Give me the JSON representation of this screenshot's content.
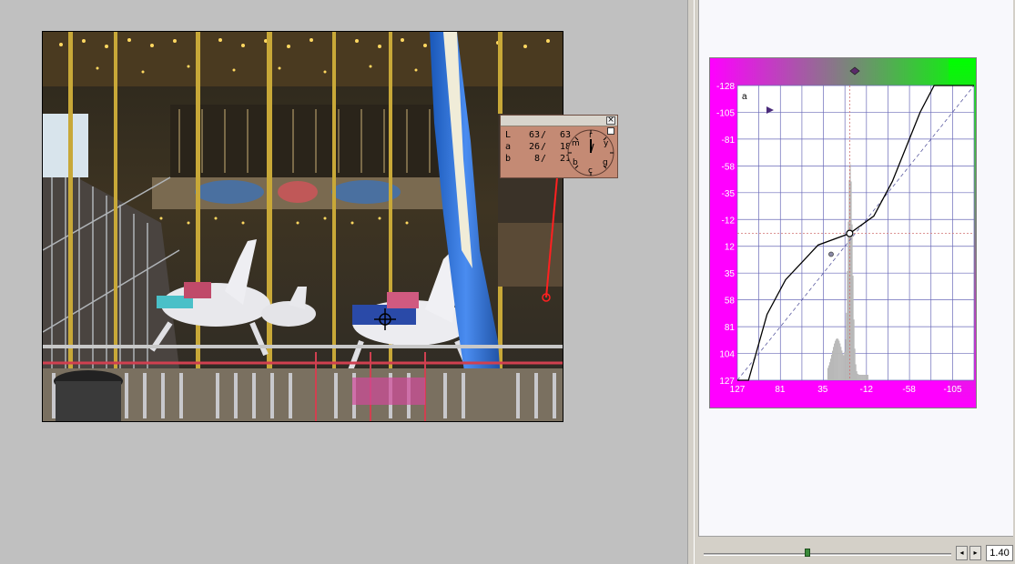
{
  "readout": {
    "rows": [
      {
        "channel": "L",
        "before": "63",
        "after": "63"
      },
      {
        "channel": "a",
        "before": "26",
        "after": "18"
      },
      {
        "channel": "b",
        "before": "8",
        "after": "21"
      }
    ],
    "dial_labels": [
      "m",
      "r",
      "y",
      "g",
      "c",
      "b"
    ],
    "close_glyph": "×",
    "pin_glyph": "▪"
  },
  "curve": {
    "channel_label": "a",
    "y_ticks": [
      "-128",
      "-105",
      "-81",
      "-58",
      "-35",
      "-12",
      "12",
      "35",
      "58",
      "81",
      "104",
      "127"
    ],
    "x_ticks": [
      "127",
      "81",
      "35",
      "-12",
      "-58",
      "-105"
    ],
    "curve_points": [
      [
        127,
        127
      ],
      [
        115,
        127
      ],
      [
        95,
        70
      ],
      [
        75,
        40
      ],
      [
        40,
        10
      ],
      [
        6,
        0
      ],
      [
        -20,
        -15
      ],
      [
        -40,
        -45
      ],
      [
        -70,
        -105
      ],
      [
        -85,
        -128
      ],
      [
        -128,
        -128
      ]
    ],
    "colors": {
      "magenta": "#ff00ff",
      "green": "#00ff00",
      "grid": "#6a6ab8",
      "curve": "#000000",
      "histogram": "#b8b8b8"
    }
  },
  "controls": {
    "zoom_value": "1.40",
    "btn_left_glyph": "◂",
    "btn_right_glyph": "▸",
    "slider_fraction": 0.42
  }
}
